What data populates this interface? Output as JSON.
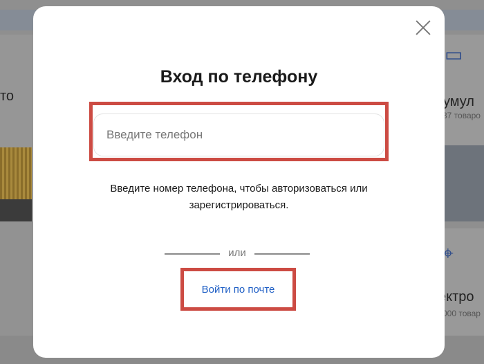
{
  "background": {
    "left_heading_fragment": "то",
    "right_heading_1": "кумул",
    "right_count_1": "37 товаро",
    "right_heading_2": "ектро",
    "right_count_2": "000 товар"
  },
  "modal": {
    "title": "Вход по телефону",
    "phone_placeholder": "Введите телефон",
    "phone_value": "",
    "hint": "Введите номер телефона, чтобы авторизоваться или зарегистрироваться.",
    "divider_text": "или",
    "email_login_label": "Войти по почте"
  },
  "colors": {
    "accent_link": "#1f5fc5",
    "highlight_border": "#cc4b43"
  }
}
